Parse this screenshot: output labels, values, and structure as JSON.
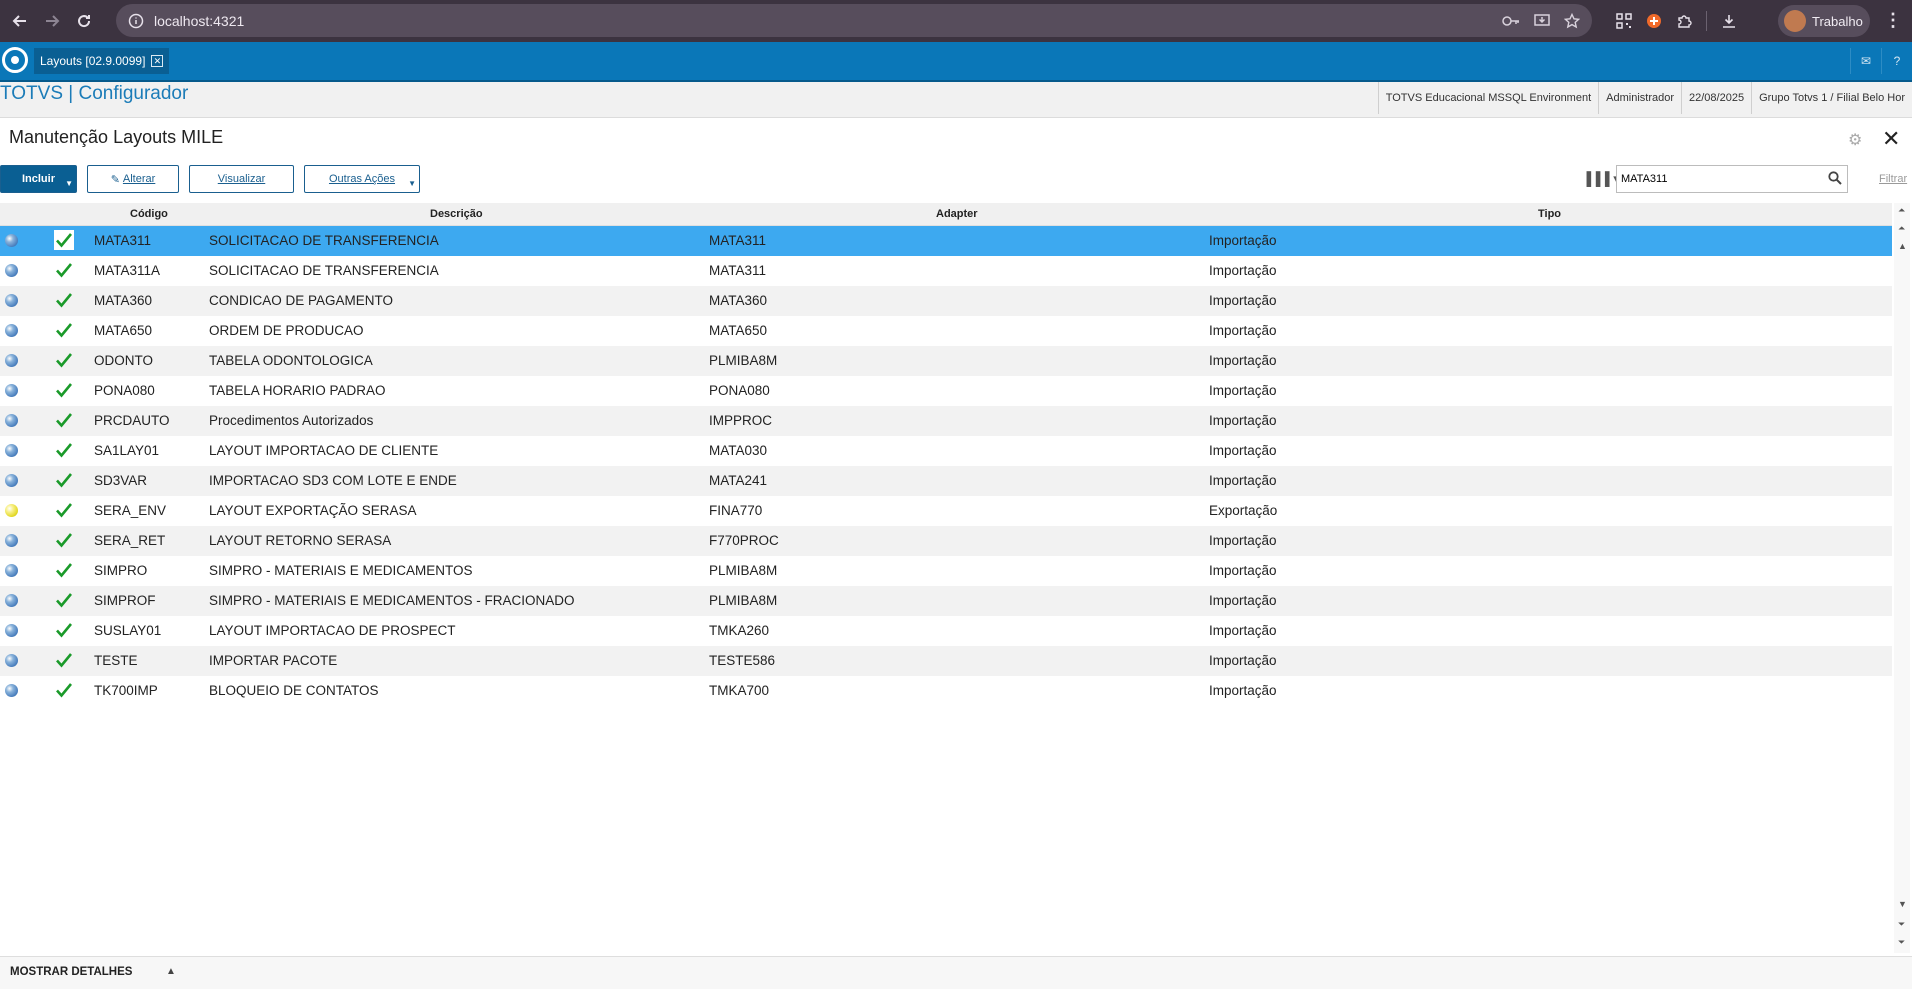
{
  "browser": {
    "url": "localhost:4321",
    "profile_name": "Trabalho"
  },
  "app_tab": {
    "label": "Layouts [02.9.0099]",
    "close": "✕"
  },
  "header": {
    "brand": "TOTVS | Configurador",
    "environment": "TOTVS Educacional MSSQL Environment",
    "user": "Administrador",
    "date": "22/08/2025",
    "branch": "Grupo Totvs 1 / Filial Belo Hor"
  },
  "page": {
    "title": "Manutenção Layouts MILE"
  },
  "toolbar": {
    "incluir": "Incluir",
    "alterar": "Alterar",
    "visualizar": "Visualizar",
    "outras_acoes": "Outras Ações",
    "search_value": "MATA311",
    "filtrar": "Filtrar"
  },
  "table": {
    "headers": {
      "codigo": "Código",
      "descricao": "Descrição",
      "adapter": "Adapter",
      "tipo": "Tipo"
    },
    "rows": [
      {
        "status": "blue",
        "codigo": "MATA311",
        "descricao": "SOLICITACAO DE TRANSFERENCIA",
        "adapter": "MATA311",
        "tipo": "Importação"
      },
      {
        "status": "blue",
        "codigo": "MATA311A",
        "descricao": "SOLICITACAO DE TRANSFERENCIA",
        "adapter": "MATA311",
        "tipo": "Importação"
      },
      {
        "status": "blue",
        "codigo": "MATA360",
        "descricao": "CONDICAO DE PAGAMENTO",
        "adapter": "MATA360",
        "tipo": "Importação"
      },
      {
        "status": "blue",
        "codigo": "MATA650",
        "descricao": "ORDEM DE PRODUCAO",
        "adapter": "MATA650",
        "tipo": "Importação"
      },
      {
        "status": "blue",
        "codigo": "ODONTO",
        "descricao": "TABELA ODONTOLOGICA",
        "adapter": "PLMIBA8M",
        "tipo": "Importação"
      },
      {
        "status": "blue",
        "codigo": "PONA080",
        "descricao": "TABELA HORARIO PADRAO",
        "adapter": "PONA080",
        "tipo": "Importação"
      },
      {
        "status": "blue",
        "codigo": "PRCDAUTO",
        "descricao": "Procedimentos Autorizados",
        "adapter": "IMPPROC",
        "tipo": "Importação"
      },
      {
        "status": "blue",
        "codigo": "SA1LAY01",
        "descricao": "LAYOUT IMPORTACAO DE CLIENTE",
        "adapter": "MATA030",
        "tipo": "Importação"
      },
      {
        "status": "blue",
        "codigo": "SD3VAR",
        "descricao": "IMPORTACAO SD3 COM LOTE E ENDE",
        "adapter": "MATA241",
        "tipo": "Importação"
      },
      {
        "status": "yellow",
        "codigo": "SERA_ENV",
        "descricao": "LAYOUT EXPORTAÇÃO SERASA",
        "adapter": "FINA770",
        "tipo": "Exportação"
      },
      {
        "status": "blue",
        "codigo": "SERA_RET",
        "descricao": "LAYOUT RETORNO SERASA",
        "adapter": "F770PROC",
        "tipo": "Importação"
      },
      {
        "status": "blue",
        "codigo": "SIMPRO",
        "descricao": "SIMPRO - MATERIAIS E MEDICAMENTOS",
        "adapter": "PLMIBA8M",
        "tipo": "Importação"
      },
      {
        "status": "blue",
        "codigo": "SIMPROF",
        "descricao": "SIMPRO - MATERIAIS E MEDICAMENTOS - FRACIONADO",
        "adapter": "PLMIBA8M",
        "tipo": "Importação"
      },
      {
        "status": "blue",
        "codigo": "SUSLAY01",
        "descricao": "LAYOUT IMPORTACAO DE PROSPECT",
        "adapter": "TMKA260",
        "tipo": "Importação"
      },
      {
        "status": "blue",
        "codigo": "TESTE",
        "descricao": "IMPORTAR PACOTE",
        "adapter": "TESTE586",
        "tipo": "Importação"
      },
      {
        "status": "blue",
        "codigo": "TK700IMP",
        "descricao": "BLOQUEIO DE CONTATOS",
        "adapter": "TMKA700",
        "tipo": "Importação"
      }
    ]
  },
  "footer": {
    "label": "MOSTRAR DETALHES"
  },
  "colors": {
    "brand_blue": "#0a77b8",
    "selected_row": "#3da9f0",
    "check_green": "#1a9a2a"
  }
}
